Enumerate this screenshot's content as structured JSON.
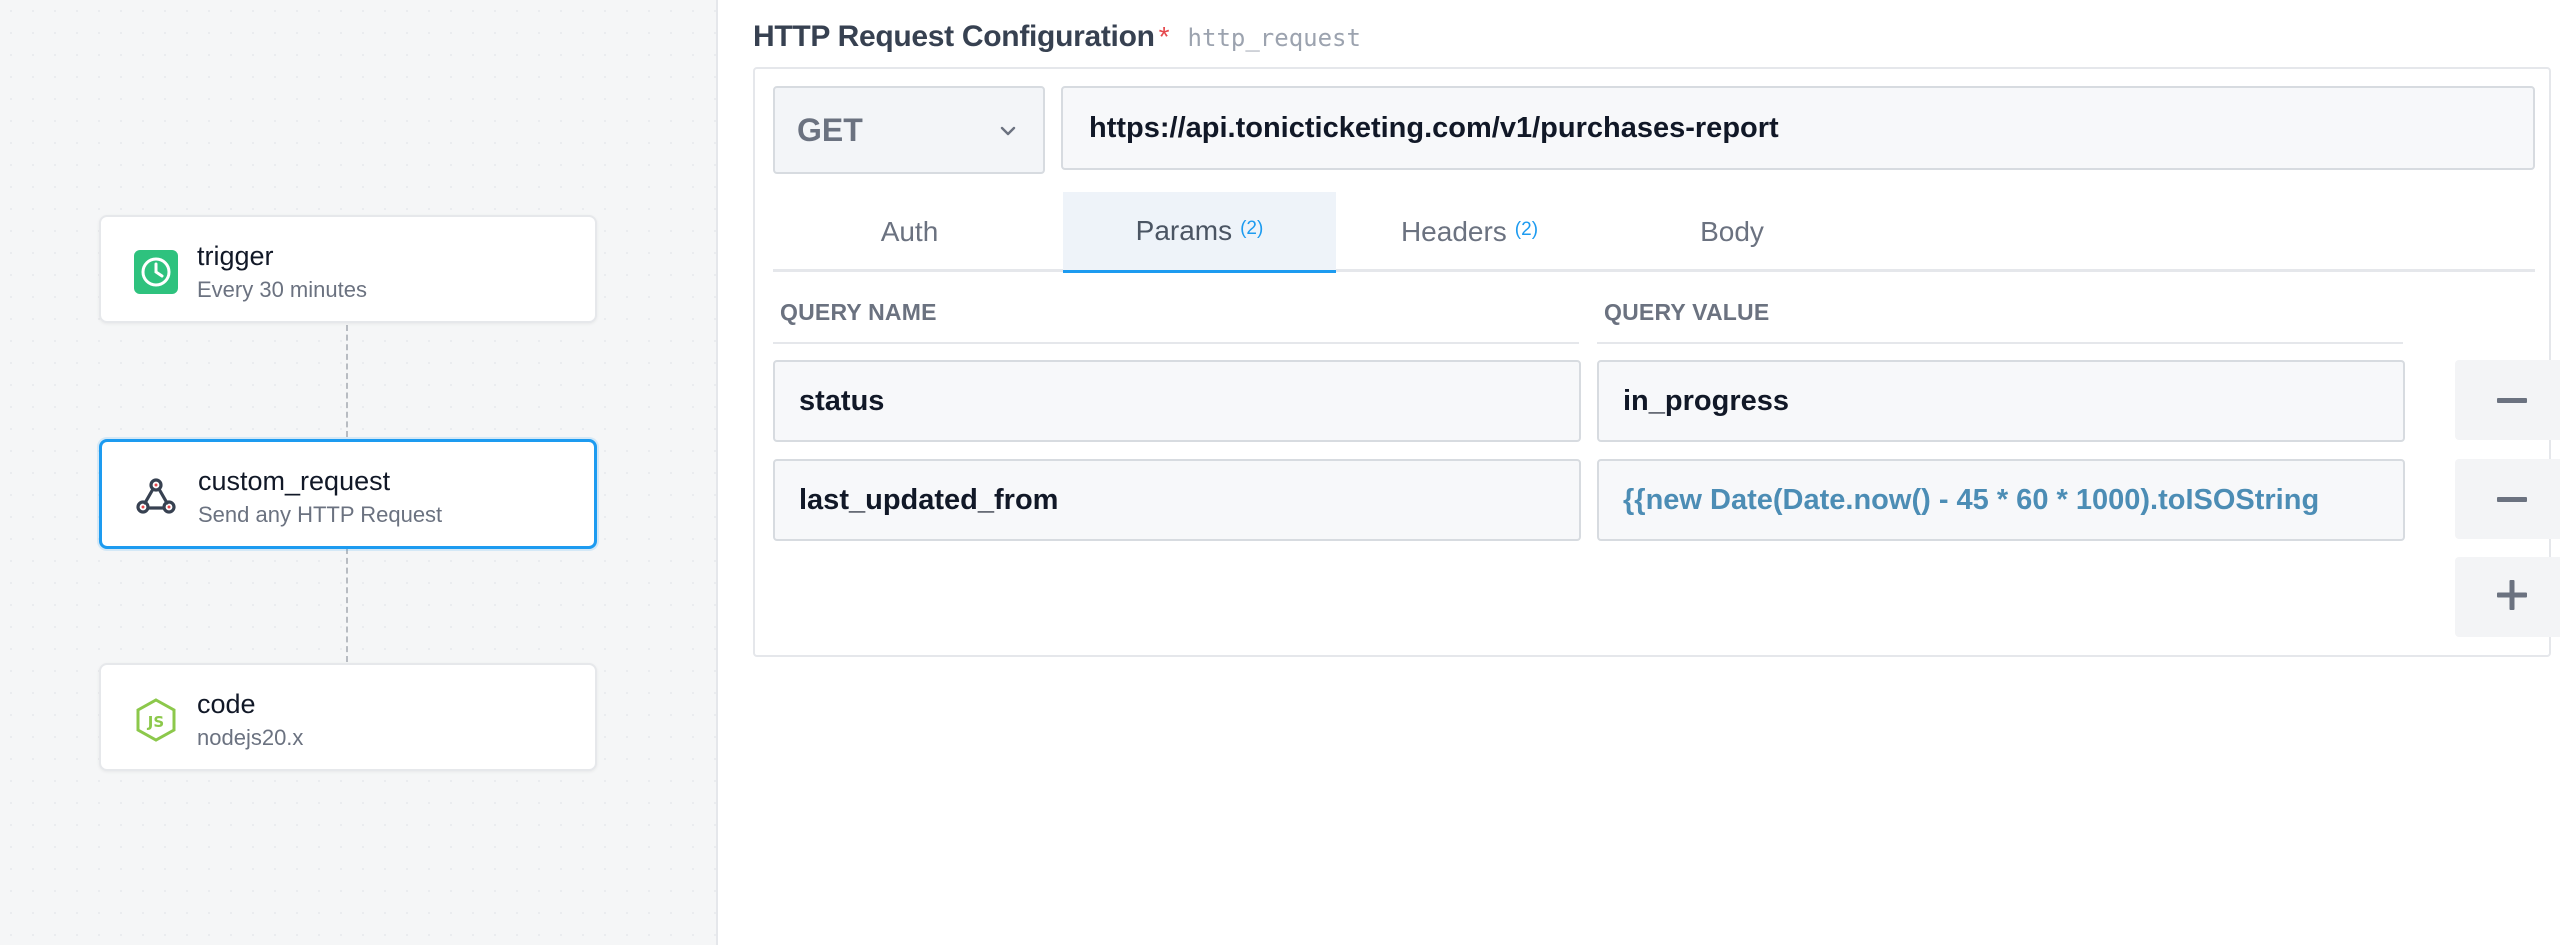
{
  "canvas": {
    "nodes": [
      {
        "title": "trigger",
        "subtitle": "Every 30 minutes",
        "icon": "clock-icon",
        "selected": false
      },
      {
        "title": "custom_request",
        "subtitle": "Send any HTTP Request",
        "icon": "webhook-icon",
        "selected": true
      },
      {
        "title": "code",
        "subtitle": "nodejs20.x",
        "icon": "nodejs-icon",
        "selected": false
      }
    ]
  },
  "config": {
    "title": "HTTP Request Configuration",
    "required_mark": "*",
    "key": "http_request",
    "method": "GET",
    "url": "https://api.tonicticketing.com/v1/purchases-report",
    "tabs": [
      {
        "label": "Auth",
        "count": ""
      },
      {
        "label": "Params",
        "count": "(2)"
      },
      {
        "label": "Headers",
        "count": "(2)"
      },
      {
        "label": "Body",
        "count": ""
      }
    ],
    "active_tab": "Params",
    "params": {
      "name_header": "QUERY NAME",
      "value_header": "QUERY VALUE",
      "rows": [
        {
          "name": "status",
          "value": "in_progress"
        },
        {
          "name": "last_updated_from",
          "value": "{{new Date(Date.now() - 45 * 60 * 1000).toISOString"
        }
      ]
    }
  },
  "colors": {
    "accent": "#1d9bf0",
    "required": "#e5484d",
    "trigger_icon_bg": "#2ec27e",
    "nodejs_icon": "#8cc84b",
    "expression_text": "#4c8db5"
  }
}
